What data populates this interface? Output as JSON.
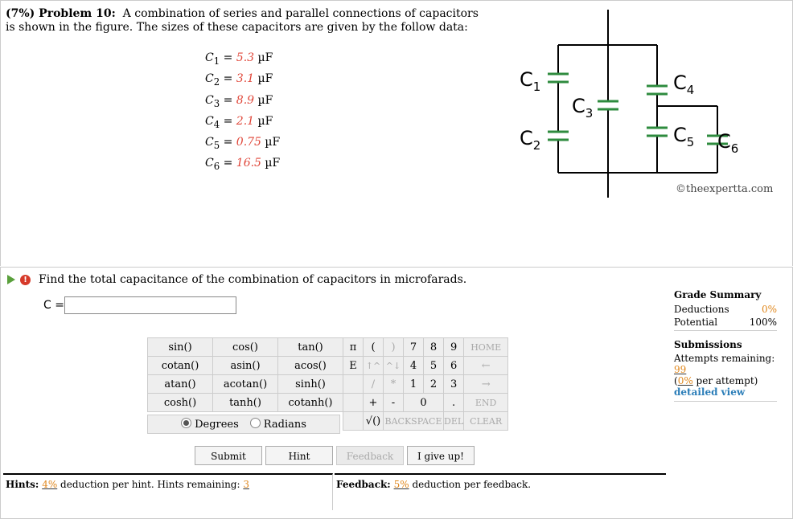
{
  "problem": {
    "heading": "(7%) Problem 10:",
    "text": "A combination of series and parallel connections of capacitors is shown in the figure. The sizes of these capacitors are given by the follow data:"
  },
  "values": [
    {
      "var": "C",
      "sub": "1",
      "eq": " = ",
      "num": "5.3",
      "unit": " µF"
    },
    {
      "var": "C",
      "sub": "2",
      "eq": " = ",
      "num": "3.1",
      "unit": " µF"
    },
    {
      "var": "C",
      "sub": "3",
      "eq": " = ",
      "num": "8.9",
      "unit": " µF"
    },
    {
      "var": "C",
      "sub": "4",
      "eq": " = ",
      "num": "2.1",
      "unit": " µF"
    },
    {
      "var": "C",
      "sub": "5",
      "eq": " = ",
      "num": "0.75",
      "unit": " µF"
    },
    {
      "var": "C",
      "sub": "6",
      "eq": " = ",
      "num": "16.5",
      "unit": " µF"
    }
  ],
  "circuit_labels": {
    "c1": "C",
    "c1s": "1",
    "c2": "C",
    "c2s": "2",
    "c3": "C",
    "c3s": "3",
    "c4": "C",
    "c4s": "4",
    "c5": "C",
    "c5s": "5",
    "c6": "C",
    "c6s": "6"
  },
  "copyright": "©theexpertta.com",
  "question": "Find the total capacitance of the combination of capacitors in microfarads.",
  "answer": {
    "label": "C =",
    "value": ""
  },
  "keypad_functions": [
    [
      "sin()",
      "cos()",
      "tan()"
    ],
    [
      "cotan()",
      "asin()",
      "acos()"
    ],
    [
      "atan()",
      "acotan()",
      "sinh()"
    ],
    [
      "cosh()",
      "tanh()",
      "cotanh()"
    ]
  ],
  "angle_modes": {
    "degrees": "Degrees",
    "radians": "Radians"
  },
  "keypad_right": {
    "r1": [
      "π",
      "(",
      ")",
      "7",
      "8",
      "9",
      "HOME"
    ],
    "r2": [
      "E",
      "↑^",
      "^↓",
      "4",
      "5",
      "6",
      "←"
    ],
    "r3": [
      "/",
      "*",
      "1",
      "2",
      "3",
      "→"
    ],
    "r4": [
      "+",
      "-",
      "0",
      ".",
      "END"
    ],
    "r5": [
      "√()",
      "BACKSPACE",
      "DEL",
      "CLEAR"
    ]
  },
  "actions": {
    "submit": "Submit",
    "hint": "Hint",
    "feedback": "Feedback",
    "giveup": "I give up!"
  },
  "hints": {
    "label": "Hints:",
    "pct": "4%",
    "text1": " deduction per hint. Hints remaining: ",
    "remaining": "3"
  },
  "feedback": {
    "label": "Feedback:",
    "pct": "5%",
    "text": " deduction per feedback."
  },
  "grade_summary": {
    "title": "Grade Summary",
    "deductions_label": "Deductions",
    "deductions_value": "0%",
    "potential_label": "Potential",
    "potential_value": "100%"
  },
  "submissions": {
    "title": "Submissions",
    "attempts_label": "Attempts remaining: ",
    "attempts_value": "99",
    "per_attempt_pct": "0%",
    "per_attempt_text": " per attempt)",
    "detailed_view": "detailed view"
  },
  "colors": {
    "accent": "#e0473a",
    "capacitor": "#2e8b3e",
    "link": "#2a7db8",
    "orange": "#e0871c"
  }
}
